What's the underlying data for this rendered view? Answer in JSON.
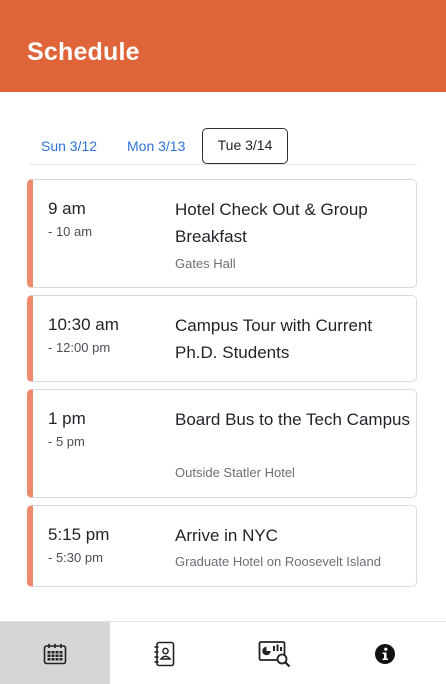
{
  "header": {
    "title": "Schedule"
  },
  "tabs": [
    {
      "label": "Sun 3/12",
      "selected": false
    },
    {
      "label": "Mon 3/13",
      "selected": false
    },
    {
      "label": "Tue 3/14",
      "selected": true
    }
  ],
  "events": [
    {
      "start": "9 am",
      "end": "- 10 am",
      "title": "Hotel Check Out & Group Breakfast",
      "location": "Gates Hall"
    },
    {
      "start": "10:30 am",
      "end": "- 12:00 pm",
      "title": "Campus Tour with Current Ph.D. Students",
      "location": ""
    },
    {
      "start": "1 pm",
      "end": "- 5 pm",
      "title": "Board Bus to the Tech Campus",
      "location": "Outside Statler Hotel"
    },
    {
      "start": "5:15 pm",
      "end": "- 5:30 pm",
      "title": "Arrive in NYC",
      "location": "Graduate Hotel on Roosevelt Island"
    }
  ],
  "bottom_nav": [
    {
      "icon": "calendar-icon",
      "active": true
    },
    {
      "icon": "contacts-book-icon",
      "active": false
    },
    {
      "icon": "chart-search-icon",
      "active": false
    },
    {
      "icon": "info-icon",
      "active": false
    }
  ],
  "colors": {
    "header_bg": "#e0643a",
    "accent_stripe": "#ee8a6c",
    "tab_link": "#2f72d9",
    "nav_active_bg": "#d6d6d6"
  }
}
